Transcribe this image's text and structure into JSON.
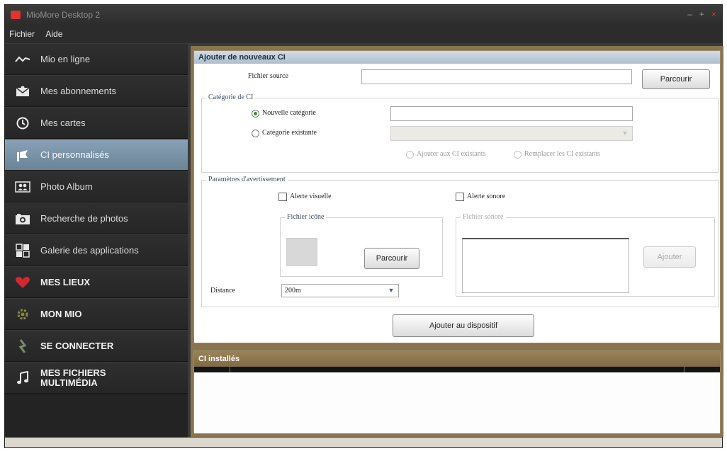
{
  "window": {
    "title": "MioMore Desktop 2",
    "controls": {
      "minimize": "–",
      "maximize": "+",
      "close": "×"
    }
  },
  "menu": [
    "Fichier",
    "Aide"
  ],
  "sidebar": {
    "items": [
      {
        "label": "Mio en ligne",
        "icon": "wave-icon"
      },
      {
        "label": "Mes abonnements",
        "icon": "envelope-icon"
      },
      {
        "label": "Mes cartes",
        "icon": "clock-icon"
      },
      {
        "label": "CI personnalisés",
        "icon": "flag-icon",
        "active": true
      },
      {
        "label": "Photo Album",
        "icon": "people-icon"
      },
      {
        "label": "Recherche de photos",
        "icon": "camera-icon"
      },
      {
        "label": "Galerie des applications",
        "icon": "grid-icon"
      },
      {
        "label": "MES LIEUX",
        "icon": "heart-icon"
      },
      {
        "label": "MON MIO",
        "icon": "gear-icon"
      },
      {
        "label": "SE CONNECTER",
        "icon": "plug-icon"
      },
      {
        "label": "MES FICHIERS\nMULTIMÉDIA",
        "icon": "music-note-icon"
      }
    ]
  },
  "add_panel": {
    "title": "Ajouter de nouveaux CI",
    "source_label": "Fichier source",
    "source_value": "",
    "browse_label": "Parcourir",
    "category_group": "Catégorie de CI",
    "new_category_label": "Nouvelle catégorie",
    "new_category_value": "",
    "existing_category_label": "Catégorie existante",
    "existing_category_value": "",
    "add_existing_label": "Ajouter aux CI existants",
    "replace_existing_label": "Remplacer les CI existants",
    "alert_group": "Paramètres d'avertissement",
    "visual_alert_label": "Alerte visuelle",
    "sound_alert_label": "Alerte sonore",
    "icon_file_group": "Fichier icône",
    "icon_browse_label": "Parcourir",
    "sound_file_group": "Fichier sonore",
    "sound_add_label": "Ajouter",
    "distance_label": "Distance",
    "distance_value": "200m",
    "add_device_label": "Ajouter au dispositif"
  },
  "installed_panel": {
    "title": "CI installés"
  },
  "colors": {
    "sidebar_bg": "#232323",
    "active_item": "#7b93a7",
    "main_frame": "#8a7450",
    "mes_lieux_heart": "#d7262e"
  }
}
